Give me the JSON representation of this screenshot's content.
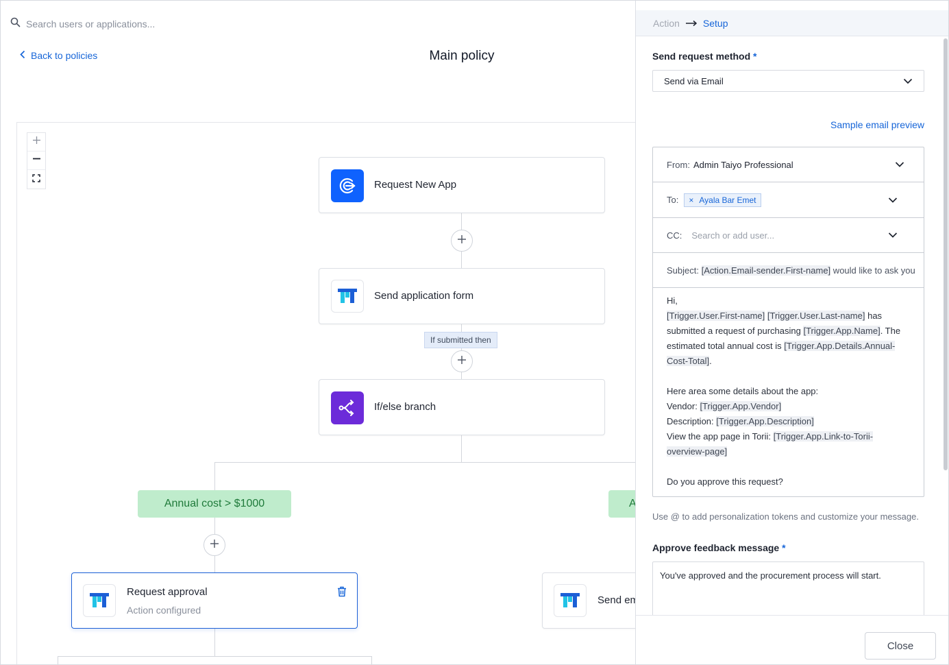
{
  "search": {
    "placeholder": "Search users or applications..."
  },
  "nav": {
    "back_label": "Back to policies",
    "title": "Main policy"
  },
  "zoom": {
    "in": "+",
    "out": "−",
    "fit": "fit"
  },
  "flow": {
    "nodes": {
      "request_new_app": "Request New App",
      "send_application_form": "Send application form",
      "if_else": "If/else branch",
      "request_approval": "Request approval",
      "request_approval_sub": "Action configured",
      "send_email_partial": "Send em"
    },
    "connector_label": "If submitted then",
    "conditions": {
      "left": "Annual cost > $1000",
      "right_partial": "A"
    }
  },
  "panel": {
    "breadcrumb": {
      "step1": "Action",
      "step2": "Setup"
    },
    "send_method": {
      "label": "Send request method",
      "required_mark": "*",
      "value": "Send via Email"
    },
    "sample_preview": "Sample email preview",
    "email": {
      "from_label": "From:",
      "from_value": "Admin Taiyo Professional",
      "to_label": "To:",
      "to_chip": "Ayala Bar Emet",
      "chip_remove": "×",
      "cc_label": "CC:",
      "cc_placeholder": "Search or add user...",
      "subject_label": "Subject:",
      "subject_token": "[Action.Email-sender.First-name]",
      "subject_rest": " would like to ask you",
      "body": {
        "greeting": "Hi,",
        "t_first": "[Trigger.User.First-name]",
        "t_last": "[Trigger.User.Last-name]",
        "l1": " has submitted a request of purchasing ",
        "t_appname": "[Trigger.App.Name]",
        "l2": ".  The estimated total annual cost is ",
        "t_cost": "[Trigger.App.Details.Annual-Cost-Total]",
        "l3": ".",
        "details_intro": "Here area some details about the app:",
        "vendor_label": "Vendor: ",
        "t_vendor": "[Trigger.App.Vendor]",
        "desc_label": "Description: ",
        "t_desc": "[Trigger.App.Description]",
        "link_label": "View the app page in Torii: ",
        "t_link": "[Trigger.App.Link-to-Torii-overview-page]",
        "question": "Do you approve this request?"
      }
    },
    "hint": "Use @ to add personalization tokens and customize your message.",
    "approve_feedback": {
      "label": "Approve feedback message",
      "required_mark": "*",
      "value": "You've approved and the procurement process will start."
    },
    "close_label": "Close"
  },
  "colors": {
    "accent": "#1665d8",
    "condition_bg": "#bfeccc",
    "condition_text": "#1f7a3a",
    "trigger_icon": "#0f62fe",
    "branch_icon": "#6c2bd9"
  },
  "icons": [
    "search-icon",
    "chevron-left-icon",
    "zoom-in-icon",
    "zoom-out-icon",
    "fit-screen-icon",
    "plus-icon",
    "trash-icon",
    "chevron-down-icon",
    "arrow-right-icon"
  ]
}
